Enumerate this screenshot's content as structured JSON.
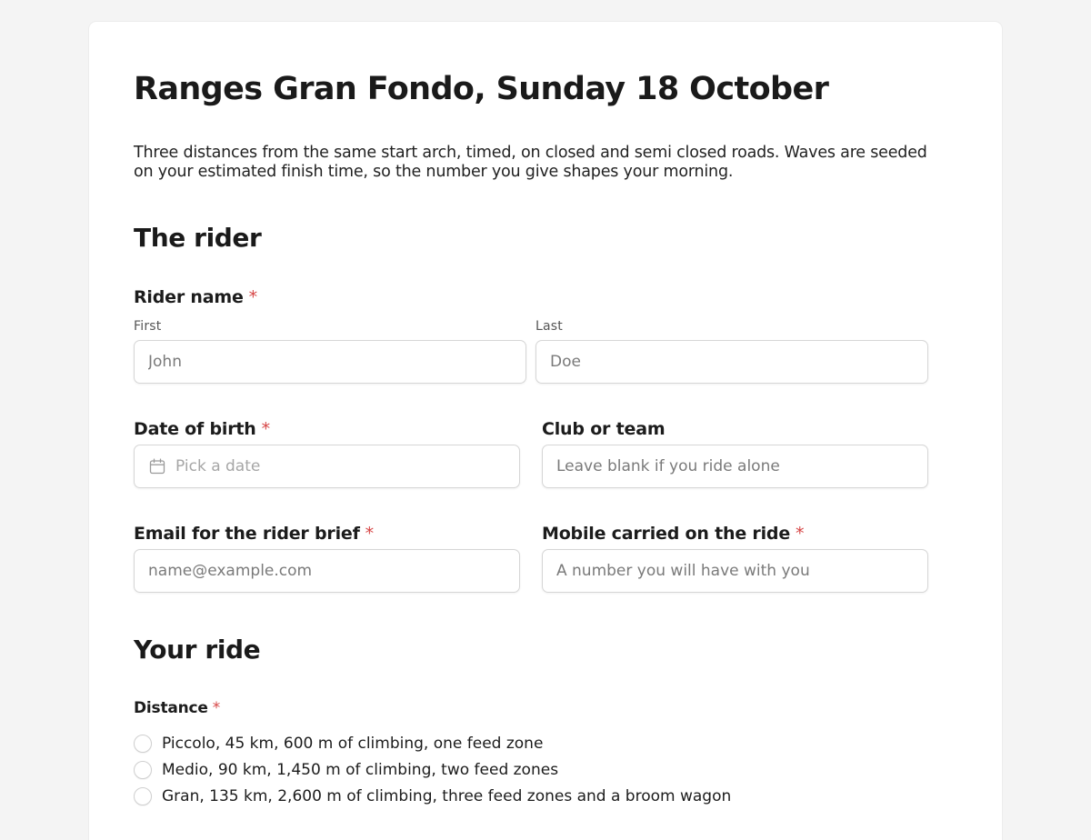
{
  "form": {
    "title": "Ranges Gran Fondo, Sunday 18 October",
    "intro": "Three distances from the same start arch, timed, on closed and semi closed roads. Waves are seeded on your estimated finish time, so the number you give shapes your morning."
  },
  "rider_section": {
    "heading": "The rider",
    "name": {
      "label": "Rider name",
      "required_mark": "*",
      "first_label": "First",
      "first_placeholder": "John",
      "last_label": "Last",
      "last_placeholder": "Doe"
    },
    "dob": {
      "label": "Date of birth",
      "required_mark": "*",
      "placeholder": "Pick a date",
      "icon": "calendar-icon"
    },
    "club": {
      "label": "Club or team",
      "placeholder": "Leave blank if you ride alone"
    },
    "email": {
      "label": "Email for the rider brief",
      "required_mark": "*",
      "placeholder": "name@example.com"
    },
    "mobile": {
      "label": "Mobile carried on the ride",
      "required_mark": "*",
      "placeholder": "A number you will have with you"
    }
  },
  "ride_section": {
    "heading": "Your ride",
    "distance": {
      "label": "Distance",
      "required_mark": "*",
      "options": [
        "Piccolo, 45 km, 600 m of climbing, one feed zone",
        "Medio, 90 km, 1,450 m of climbing, two feed zones",
        "Gran, 135 km, 2,600 m of climbing, three feed zones and a broom wagon"
      ]
    }
  },
  "colors": {
    "required": "#d64545",
    "page_background": "#f4f4f4",
    "card_background": "#ffffff"
  }
}
